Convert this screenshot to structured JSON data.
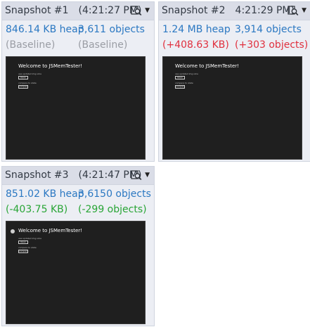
{
  "snapshots": [
    {
      "title": "Snapshot #1",
      "time": "(4:21:27 PM)",
      "heap": "846.14 KB heap",
      "objects": "3,611 objects",
      "heap_delta": "(Baseline)",
      "objects_delta": "(Baseline)",
      "delta_color": "#9a9da4",
      "preview": {
        "title": "Welcome to JSMemTester!",
        "label1": "use updated img slice",
        "button1": "Open",
        "label2": "compare to state",
        "button2": "compare"
      }
    },
    {
      "title": "Snapshot #2",
      "time": "4:21:29 PM)",
      "heap": "1.24 MB heap",
      "objects": "3,914 objects",
      "heap_delta": "(+408.63 KB)",
      "objects_delta": "(+303 objects)",
      "delta_color": "#e0303e",
      "preview": {
        "title": "Welcome to JSMemTester!",
        "label1": "use updated img slice",
        "button1": "Open",
        "label2": "compare to state",
        "button2": "compare"
      }
    },
    {
      "title": "Snapshot #3",
      "time": "(4:21:47 PM)",
      "heap": "851.02 KB heap",
      "objects": "3,6150 objects",
      "heap_delta": "(-403.75 KB)",
      "objects_delta": "(-299 objects)",
      "delta_color": "#29a536",
      "preview": {
        "title": "Welcome to JSMemTester!",
        "label1": "use updated img slice",
        "button1": "Open",
        "label2": "compare to state",
        "button2": "compare"
      }
    }
  ],
  "icons": {
    "compare": "compare-snapshots-icon",
    "dropdown": "dropdown-arrow-icon"
  },
  "colors": {
    "heap_text": "#2b78c2",
    "tile_bg": "#eceef4",
    "header_bg": "#dadde7",
    "preview_bg": "#1f1f1f"
  }
}
